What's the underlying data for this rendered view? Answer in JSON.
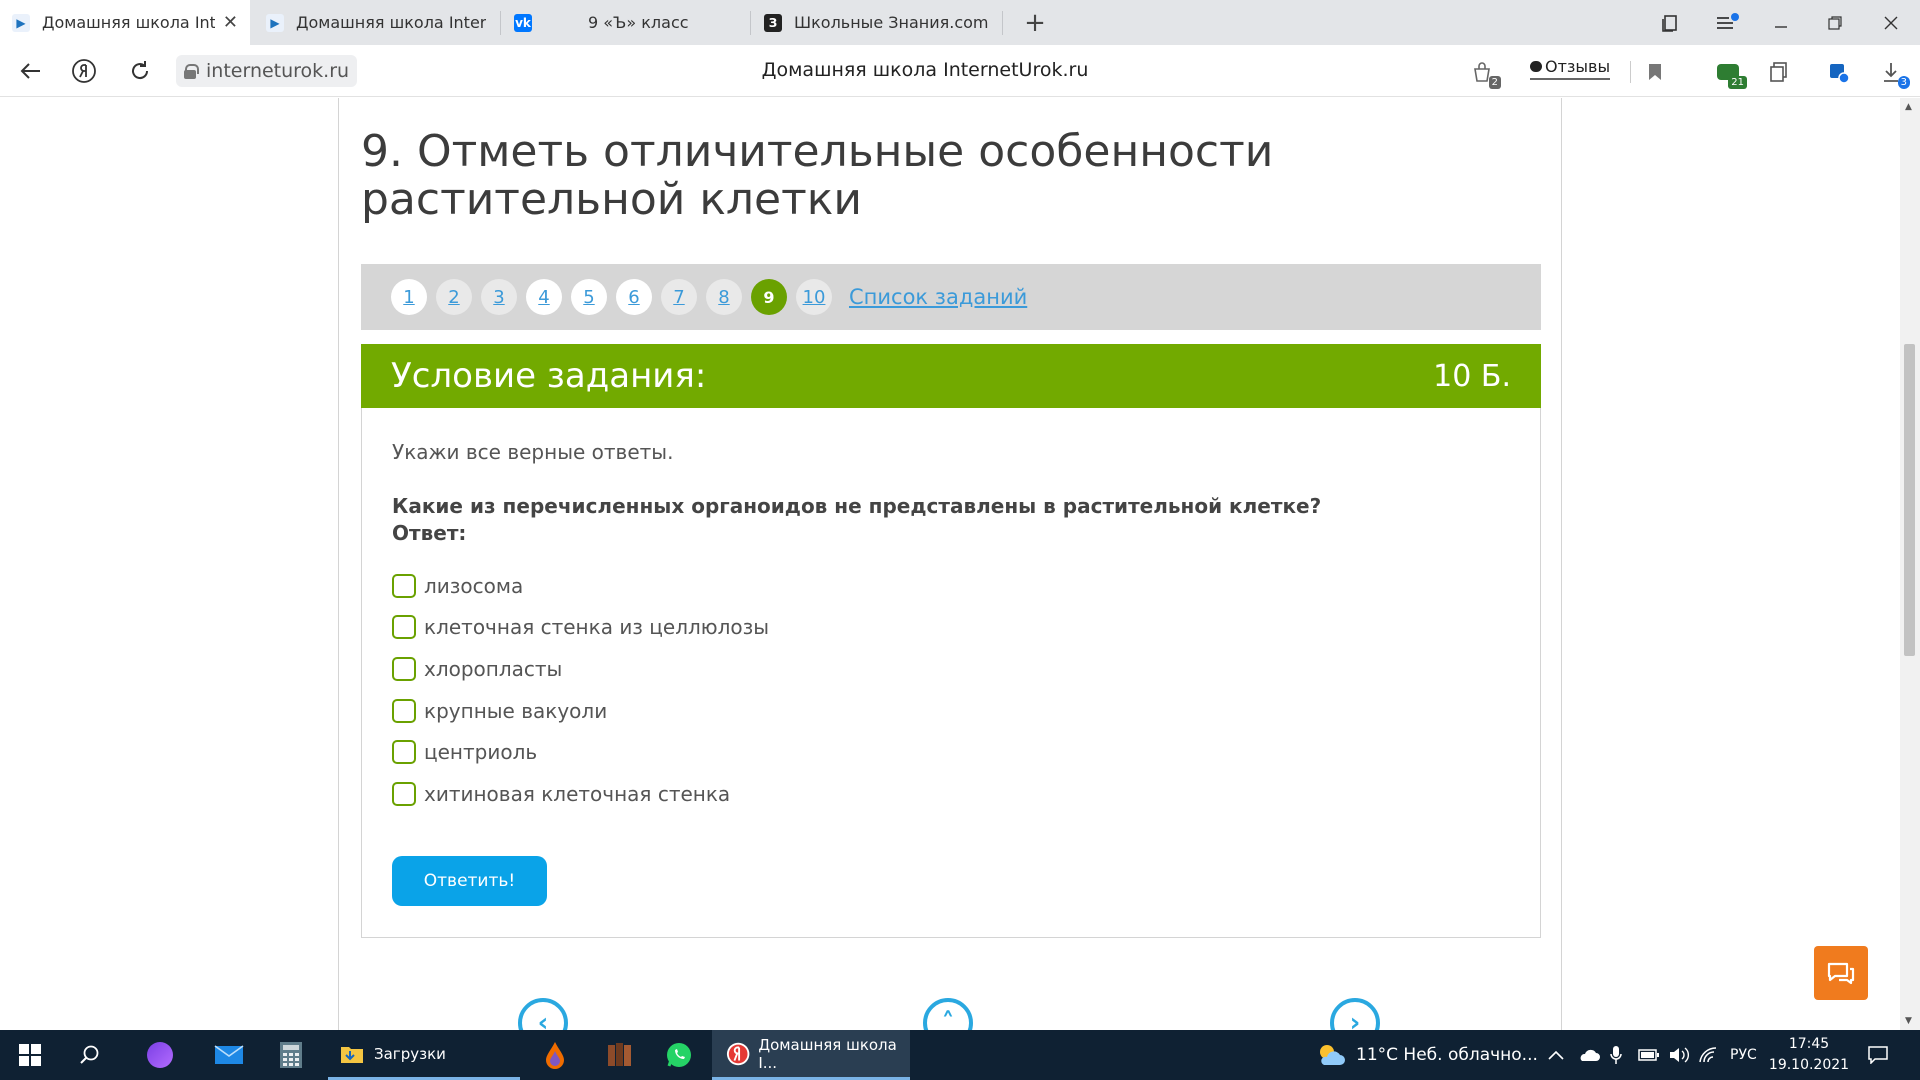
{
  "browser": {
    "tabs": [
      {
        "title": "Домашняя школа Inter",
        "close": "✕",
        "favicon": "▶"
      },
      {
        "title": "Домашняя школа Internet",
        "favicon": "▶"
      },
      {
        "title": "9 «Ъ» класс",
        "favicon": "vk"
      },
      {
        "title": "Школьные Знания.com - Р",
        "favicon": "З"
      }
    ],
    "new_tab": "+",
    "url": "interneturok.ru",
    "page_title": "Домашняя школа InternetUrok.ru",
    "reviews_label": "Отзывы",
    "badges": {
      "left": "2",
      "mail": "21",
      "downloads": "3"
    }
  },
  "page": {
    "heading": "9. Отметь отличительные особенности растительной клетки",
    "pagination": [
      "1",
      "2",
      "3",
      "4",
      "5",
      "6",
      "7",
      "8",
      "9",
      "10"
    ],
    "current_page": "9",
    "task_list_link": "Список заданий",
    "task": {
      "header": "Условие задания:",
      "points": "10 Б.",
      "instruction": "Укажи все верные ответы.",
      "question": "Какие из перечисленных органоидов не представлены в растительной клетке?",
      "answer_label": "Ответ:",
      "options": [
        "лизосома",
        "клеточная стенка из целлюлозы",
        "хлоропласты",
        "крупные вакуоли",
        "центриоль",
        "хитиновая клеточная стенка"
      ],
      "submit_label": "Ответить!"
    },
    "nav": {
      "prev": "‹",
      "up": "˄",
      "next": "›"
    }
  },
  "taskbar": {
    "downloads_label": "Загрузки",
    "browser_window": "Домашняя школа I...",
    "weather": "11°C  Неб. облачно...",
    "language": "РУС",
    "time": "17:45",
    "date": "19.10.2021"
  },
  "colors": {
    "accent_green": "#72aa00",
    "link_blue": "#3b9ad9",
    "button_blue": "#0aa3e8",
    "chat_orange": "#f07b1e"
  }
}
